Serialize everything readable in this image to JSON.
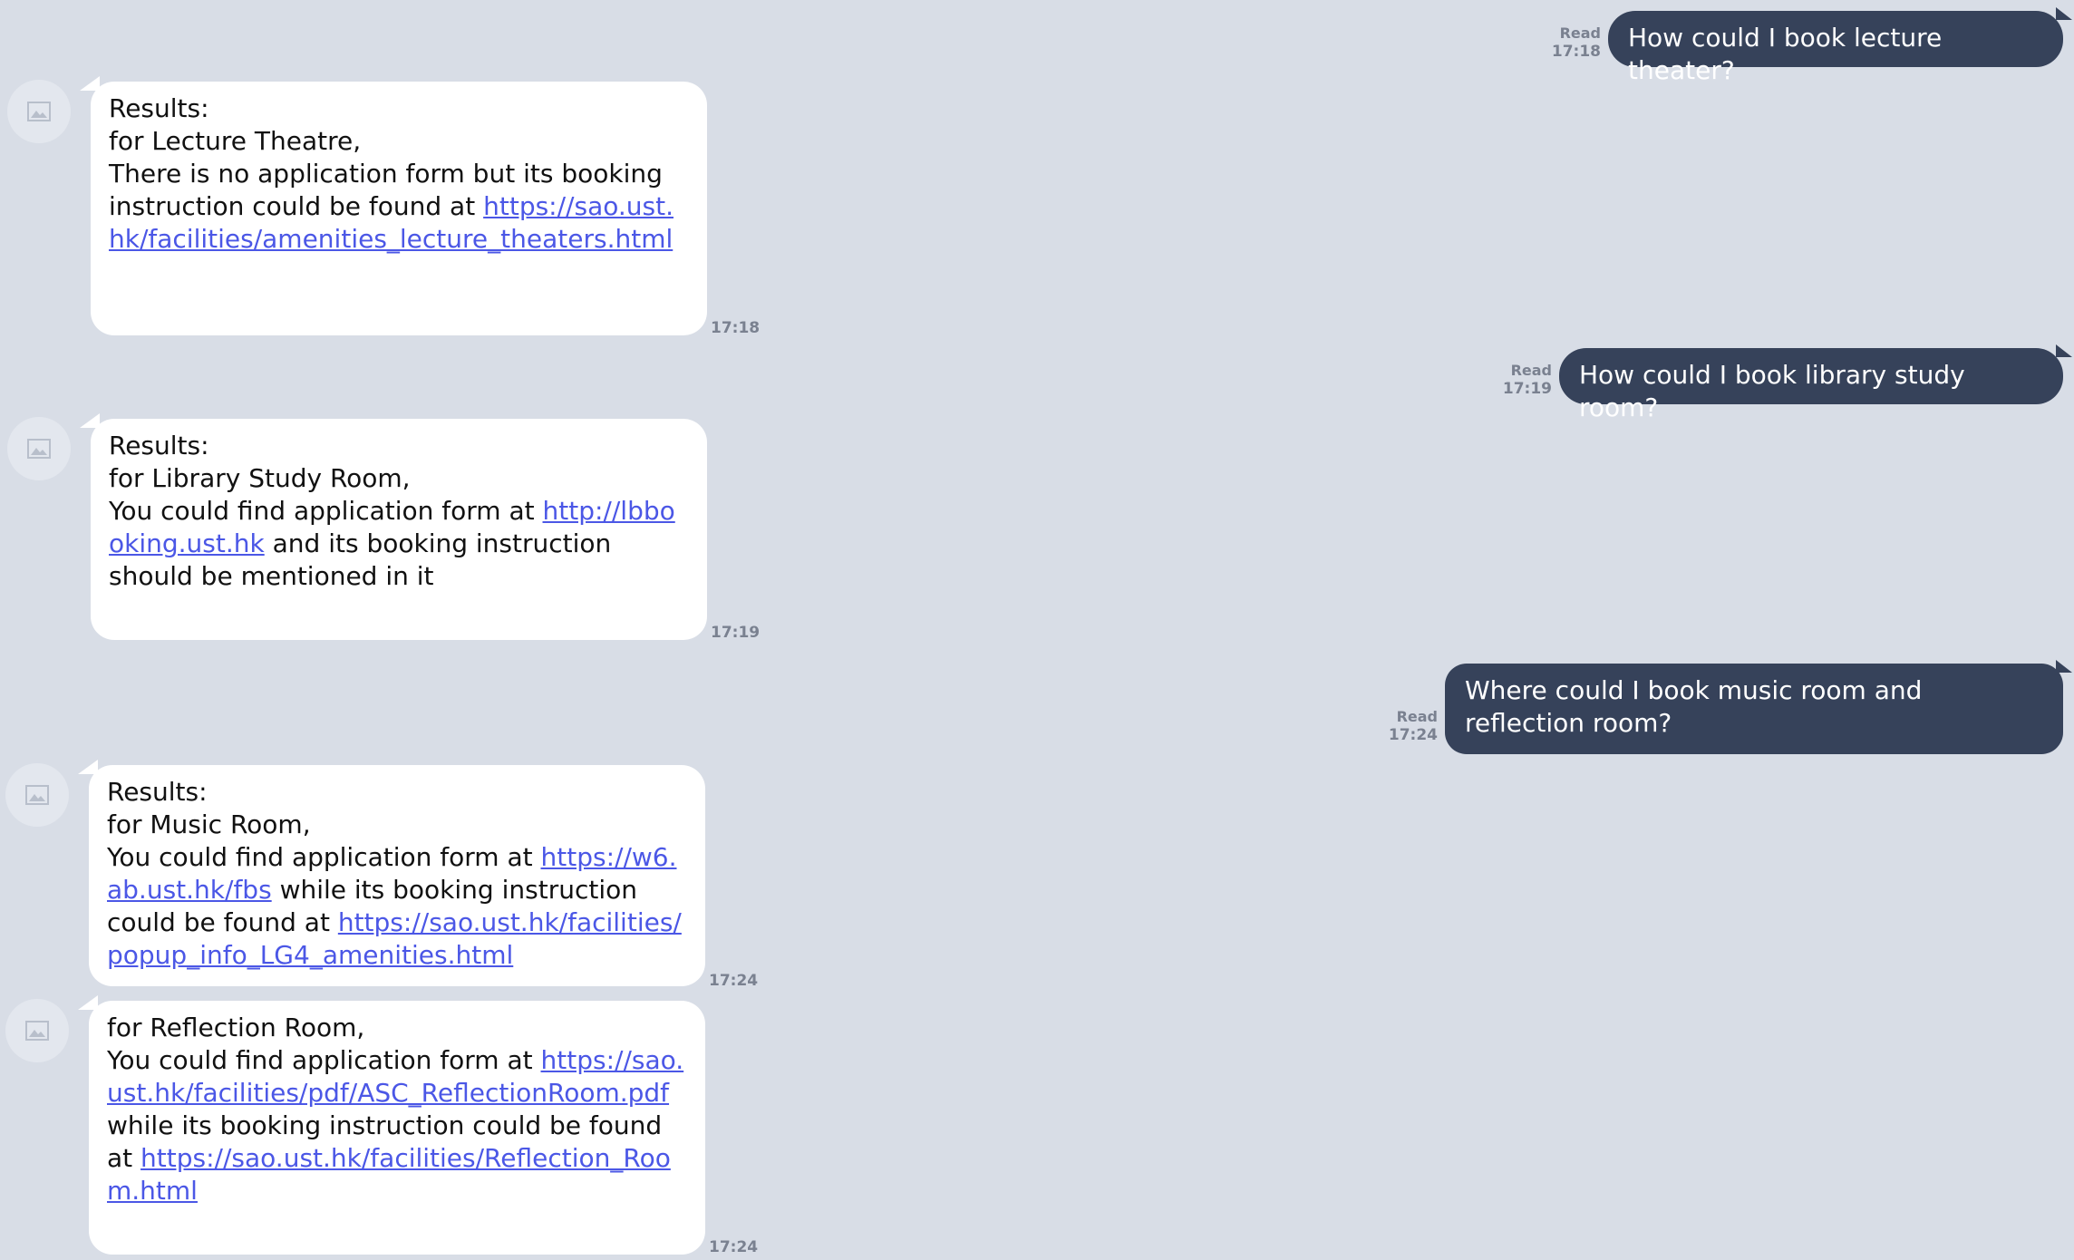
{
  "conversation": {
    "sent": [
      {
        "read_label": "Read",
        "time": "17:18",
        "text": "How could I book lecture theater?"
      },
      {
        "read_label": "Read",
        "time": "17:19",
        "text": "How could I book library study room?"
      },
      {
        "read_label": "Read",
        "time": "17:24",
        "text": "Where could I book music room and reflection room?"
      }
    ],
    "received": [
      {
        "time": "17:18",
        "lines": [
          "Results:",
          "for Lecture Theatre,",
          "There is no application form but its booking instruction could be found at "
        ],
        "link1": "https://sao.ust.hk/facilities/amenities_lecture_theaters.html"
      },
      {
        "time": "17:19",
        "lines": [
          "Results:",
          "for Library Study Room,",
          "You could find application form at "
        ],
        "link1": "http://lbbooking.ust.hk",
        "after_link1": " and its booking instruction should be mentioned in it"
      },
      {
        "time": "17:24",
        "lines": [
          "Results:",
          "for Music Room,",
          "You could find application form at "
        ],
        "link1": "https://w6.ab.ust.hk/fbs",
        "after_link1": " while its booking instruction could be found at ",
        "link2": "https://sao.ust.hk/facilities/popup_info_LG4_amenities.html"
      },
      {
        "time": "17:24",
        "lines": [
          "for Reflection Room,",
          "You could find application form at "
        ],
        "link1": "https://sao.ust.hk/facilities/pdf/ASC_ReflectionRoom.pdf",
        "after_link1": " while its booking instruction could be found at ",
        "link2": "https://sao.ust.hk/facilities/Reflection_Room.html"
      }
    ]
  }
}
